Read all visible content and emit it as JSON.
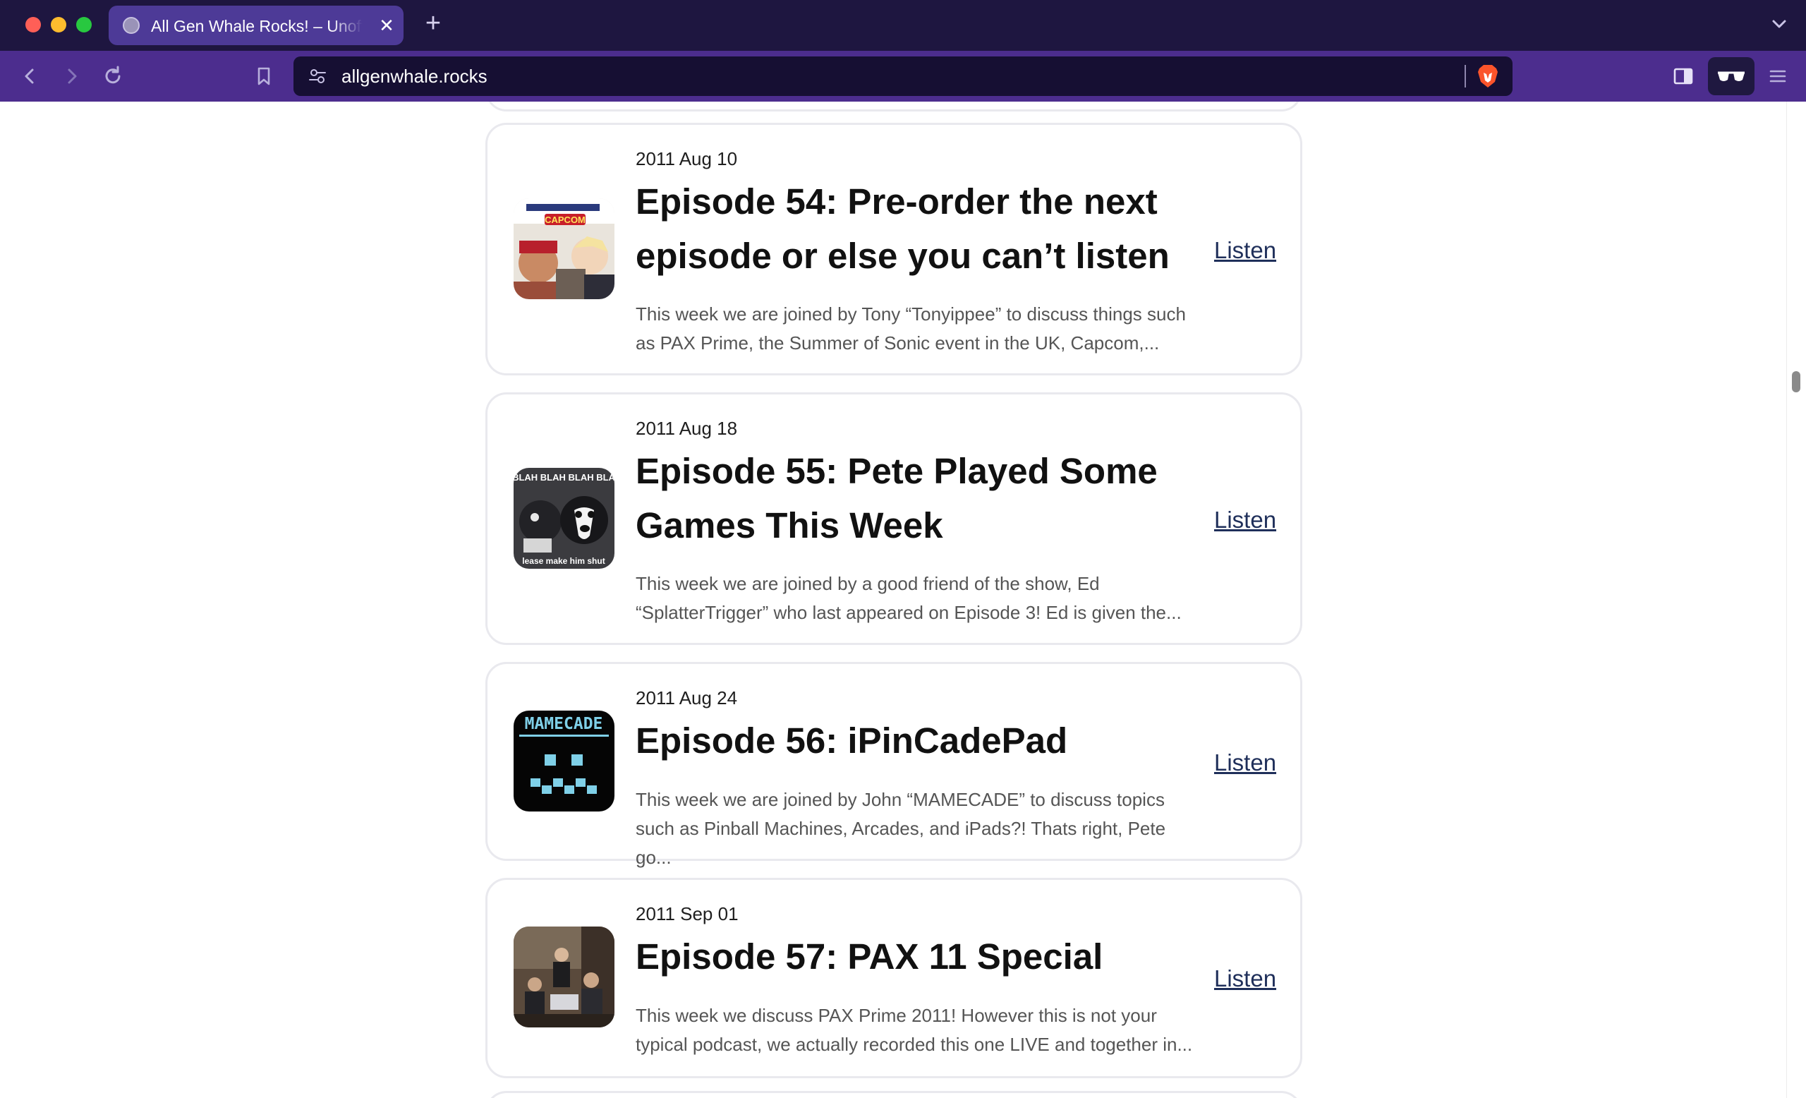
{
  "browser": {
    "tab": {
      "title": "All Gen Whale Rocks! – Unofficial",
      "close_label": "✕"
    },
    "new_tab_label": "+",
    "url": "allgenwhale.rocks"
  },
  "colors": {
    "tabbar_bg": "#1e1640",
    "toolbar_bg": "#4c2d8e",
    "active_tab_bg": "#4d3a97",
    "urlbar_bg": "#160f33",
    "brave_orange": "#fb542b",
    "listen_link": "#1f2f5a"
  },
  "icons": {
    "tab_favicon": "globe-icon",
    "back": "chevron-left-icon",
    "forward": "chevron-right-icon",
    "reload": "reload-icon",
    "bookmark": "bookmark-icon",
    "site_info": "tune-icon",
    "shields": "brave-lion-icon",
    "sidebar": "sidebar-icon",
    "wallet": "sunglasses-icon",
    "menu": "hamburger-icon",
    "tab_list": "chevron-down-icon"
  },
  "episodes": [
    {
      "date": "2011 Aug 10",
      "title": "Episode 54: Pre-order the next episode or else you can’t listen",
      "description": "This week we are joined by Tony “Tonyippee” to discuss things such as PAX Prime, the Summer of Sonic event in the UK, Capcom,...",
      "listen_label": "Listen",
      "thumbnail_text": "CAPCOM"
    },
    {
      "date": "2011 Aug 18",
      "title": "Episode 55: Pete Played Some Games This Week",
      "description": "This week we are joined by a good friend of the show, Ed “SplatterTrigger” who last appeared on Episode 3! Ed is given the...",
      "listen_label": "Listen",
      "thumbnail_text_top": "BLAH BLAH BLAH BLA",
      "thumbnail_text_bottom": "lease make him shut"
    },
    {
      "date": "2011 Aug 24",
      "title": "Episode 56: iPinCadePad",
      "description": "This week we are joined by John “MAMECADE” to discuss topics such as Pinball Machines, Arcades, and iPads?! Thats right, Pete go...",
      "listen_label": "Listen",
      "thumbnail_text": "MAMECADE"
    },
    {
      "date": "2011 Sep 01",
      "title": "Episode 57: PAX 11 Special",
      "description": "This week we discuss PAX Prime 2011! However this is not your typical podcast, we actually recorded this one LIVE and together in...",
      "listen_label": "Listen"
    }
  ]
}
